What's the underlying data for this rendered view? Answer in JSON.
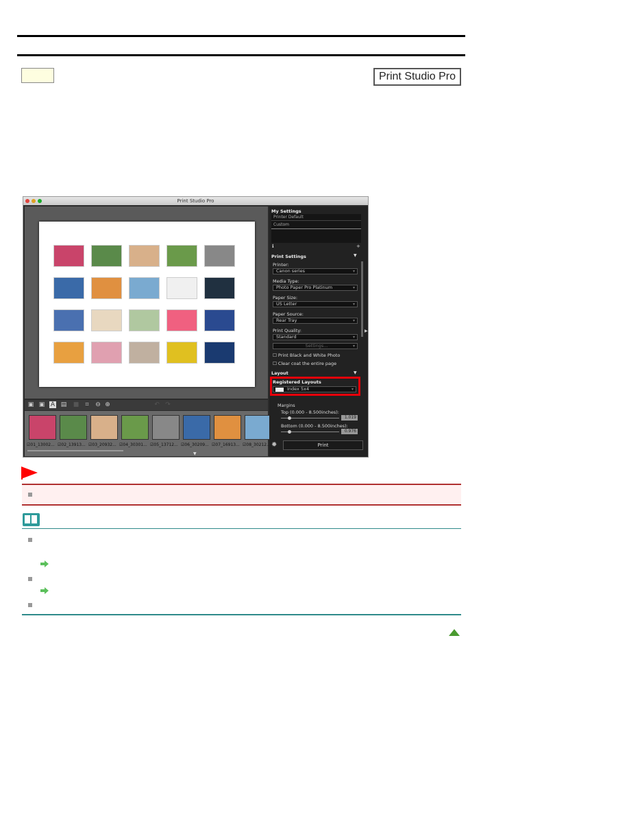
{
  "header": {
    "badge": "Print Studio Pro"
  },
  "window": {
    "title": "Print Studio Pro",
    "my_settings": {
      "title": "My Settings",
      "items": [
        "Printer Default",
        "Custom"
      ]
    },
    "print_settings": {
      "title": "Print Settings",
      "printer": {
        "label": "Printer:",
        "value": "Canon         series"
      },
      "media_type": {
        "label": "Media Type:",
        "value": "Photo Paper Pro Platinum"
      },
      "paper_size": {
        "label": "Paper Size:",
        "value": "US Letter"
      },
      "paper_source": {
        "label": "Paper Source:",
        "value": "Rear Tray"
      },
      "print_quality": {
        "label": "Print Quality:",
        "value": "Standard"
      },
      "settings_button": "Settings...",
      "bw_checkbox": "Print Black and White Photo",
      "clear_coat_checkbox": "Clear coat the entire page"
    },
    "layout": {
      "title": "Layout",
      "registered_label": "Registered Layouts",
      "registered_value": "Index 5x4",
      "margins": "Margins",
      "top_label": "Top (0.000 - 8.500inches):",
      "top_value": "1.019",
      "bottom_label": "Bottom (0.000 - 8.500inches):",
      "bottom_value": "0.976"
    },
    "print_button": "Print",
    "filmstrip": [
      "01_13002...",
      "02_13913...",
      "03_20932...",
      "04_30301...",
      "05_13712...",
      "06_30209...",
      "07_16913...",
      "08_30212..."
    ],
    "photo_colors": [
      "#c9446a",
      "#5a8a4a",
      "#d8b08a",
      "#6a9a4a",
      "#888888",
      "#3a6aa8",
      "#e09040",
      "#7aaad0",
      "#f0f0f0",
      "#203040",
      "#4a70b0",
      "#e8d8c0",
      "#b0c8a0",
      "#f06080",
      "#2a4a90",
      "#e8a040",
      "#e0a0b0",
      "#c0b0a0",
      "#e0c020",
      "#1a3a70"
    ],
    "highlight_color": "#e8000a"
  },
  "notes": {
    "important_color": "#c03030",
    "note_color": "#2e8a8a"
  }
}
